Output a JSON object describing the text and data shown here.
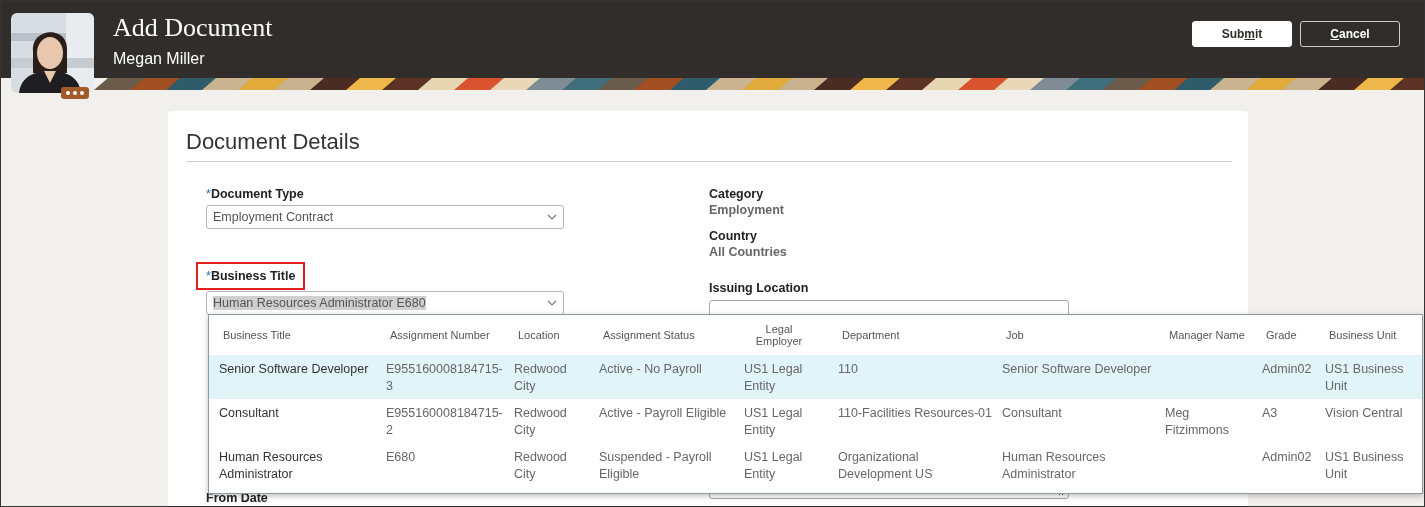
{
  "header": {
    "title": "Add Document",
    "subtitle": "Megan Miller",
    "buttons": [
      {
        "label_start": "Sub",
        "access_key": "m",
        "label_end": "it",
        "kind": "primary"
      },
      {
        "access_key": "C",
        "label_end": "ancel",
        "kind": "secondary"
      }
    ]
  },
  "section": {
    "title": "Document Details"
  },
  "left_fields": [
    {
      "label": "Document Type",
      "required_mark": "*",
      "value": "Employment Contract",
      "highlighted": false,
      "text_selected": false
    },
    {
      "label": "Business Title",
      "required_mark": "*",
      "value": "Human Resources Administrator E680",
      "highlighted": true,
      "text_selected": true
    }
  ],
  "from_date": {
    "label": "From Date"
  },
  "right_fields": [
    {
      "label": "Category",
      "value": "Employment"
    },
    {
      "label": "Country",
      "value": "All Countries"
    }
  ],
  "issuing_location": {
    "label": "Issuing Location"
  },
  "dropdown": {
    "columns": [
      "Business Title",
      "Assignment Number",
      "Location",
      "Assignment Status",
      "Legal Employer",
      "Department",
      "Job",
      "Manager Name",
      "Grade",
      "Business Unit"
    ],
    "rows": [
      {
        "selected": true,
        "cells": [
          "Senior Software Developer",
          "E955160008184715-3",
          "Redwood City",
          "Active - No Payroll",
          "US1 Legal Entity",
          "110",
          "Senior Software Developer",
          null,
          "Admin02",
          "US1 Business Unit"
        ]
      },
      {
        "selected": false,
        "cells": [
          "Consultant",
          "E955160008184715-2",
          "Redwood City",
          "Active - Payroll Eligible",
          "US1 Legal Entity",
          "110-Facilities Resources-01",
          "Consultant",
          "Meg Fitzimmons",
          "A3",
          "Vision Central"
        ]
      },
      {
        "selected": false,
        "cells": [
          "Human Resources Administrator",
          "E680",
          "Redwood City",
          "Suspended - Payroll Eligible",
          "US1 Legal Entity",
          "Organizational Development US",
          "Human Resources Administrator",
          null,
          "Admin02",
          "US1 Business Unit"
        ]
      }
    ]
  }
}
